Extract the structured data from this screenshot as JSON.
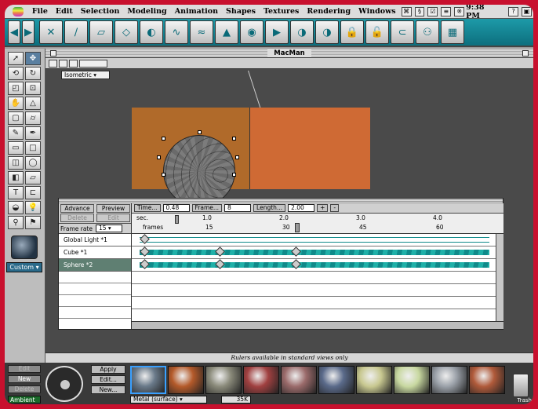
{
  "menubar": {
    "items": [
      "File",
      "Edit",
      "Selection",
      "Modeling",
      "Animation",
      "Shapes",
      "Textures",
      "Rendering",
      "Windows"
    ],
    "clock": "9:38 PM"
  },
  "document": {
    "title": "MacMan",
    "view_menu": "Isometric",
    "status": "Rulers available in standard views only"
  },
  "palette": {
    "custom_label": "Custom"
  },
  "timeline": {
    "advance": "Advance",
    "preview": "Preview",
    "delete": "Delete",
    "edit": "Edit",
    "frame_rate_label": "Frame rate",
    "frame_rate_value": "15",
    "time_label": "Time...",
    "time_value": "0.48",
    "frame_label": "Frame...",
    "frame_value": "8",
    "length_label": "Length...",
    "length_value": "2.00",
    "plus": "+",
    "minus": "-",
    "sec_label": "sec.",
    "frames_label": "frames",
    "sec_ticks": [
      "1.0",
      "2.0",
      "3.0",
      "4.0"
    ],
    "frame_ticks": [
      "15",
      "30",
      "45",
      "60"
    ],
    "tracks": [
      "Global Light *1",
      "Cube *1",
      "Sphere *2"
    ]
  },
  "materials": {
    "edit": "Edit",
    "new": "New",
    "delete": "Delete",
    "ambient": "Ambient",
    "apply": "Apply",
    "edit_dots": "Edit...",
    "new_dots": "New...",
    "selected": "Metal (surface)",
    "memory": "35K",
    "trash": "Trash",
    "swatch_colors": [
      "#6a7a8a",
      "#b45a2a",
      "#8a8a7a",
      "#a04040",
      "#9a6a6a",
      "#5a6a8a",
      "#c8c890",
      "#c8d8a0",
      "#9aa0a8",
      "#b05a3a"
    ]
  }
}
